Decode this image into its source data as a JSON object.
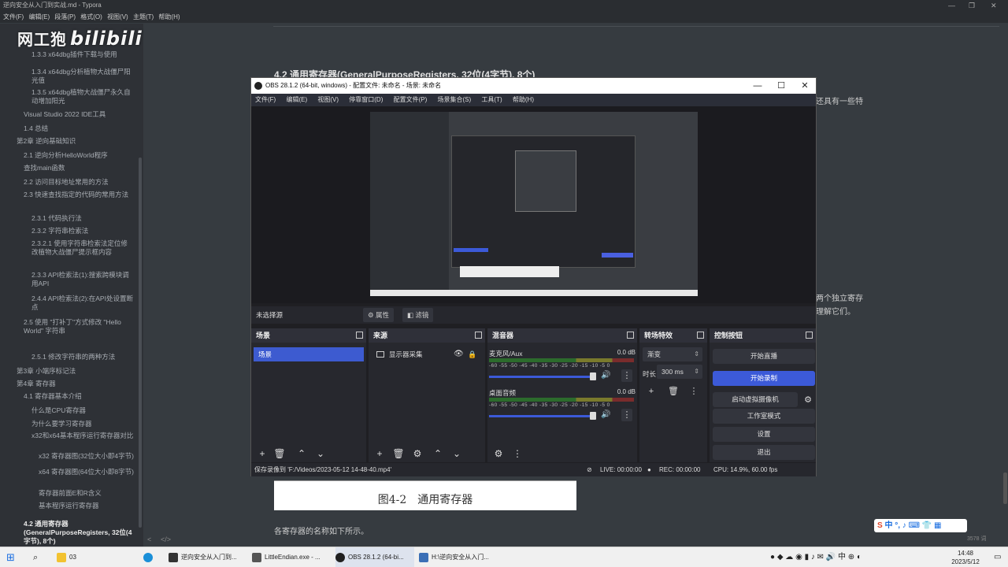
{
  "typora": {
    "title": "逆向安全从入门到实战.md - Typora",
    "menu": [
      "文件(F)",
      "编辑(E)",
      "段落(P)",
      "格式(O)",
      "视图(V)",
      "主题(T)",
      "帮助(H)"
    ],
    "toc": [
      {
        "text": "1.3.3 x64dbg插件下载与使用",
        "indent": 40,
        "active": false
      },
      {
        "text": "1.3.4 x64dbg分析植物大战僵尸阳光值",
        "indent": 40,
        "active": false
      },
      {
        "text": "1.3.5 x64dbg植物大战僵尸永久自动增加阳光",
        "indent": 40,
        "active": false
      },
      {
        "text": "Visual Studio 2022 IDE工具",
        "indent": 30,
        "active": false
      },
      {
        "text": "1.4 总结",
        "indent": 30,
        "active": false
      },
      {
        "text": "第2章 逆向基础知识",
        "indent": 21,
        "active": false
      },
      {
        "text": "2.1 逆向分析HelloWorld程序",
        "indent": 30,
        "active": false
      },
      {
        "text": "查找main函数",
        "indent": 30,
        "active": false
      },
      {
        "text": "2.2 访问目标地址常用的方法",
        "indent": 30,
        "active": false
      },
      {
        "text": "2.3 快速查找指定的代码的常用方法",
        "indent": 30,
        "active": false
      },
      {
        "text": "2.3.1 代码执行法",
        "indent": 40,
        "active": false
      },
      {
        "text": "2.3.2 字符串检索法",
        "indent": 40,
        "active": false
      },
      {
        "text": "2.3.2.1 使用字符串检索法定位修改植物大战僵尸提示框内容",
        "indent": 40,
        "active": false
      },
      {
        "text": "2.3.3 API检索法(1):搜索跨模块调用API",
        "indent": 40,
        "active": false
      },
      {
        "text": "2.4.4 API检索法(2):在API处设置断点",
        "indent": 40,
        "active": false
      },
      {
        "text": "2.5 使用 \"打补丁\"方式修改 \"Hello World\" 字符串",
        "indent": 30,
        "active": false
      },
      {
        "text": "2.5.1 修改字符串的两种方法",
        "indent": 40,
        "active": false
      },
      {
        "text": "第3章 小端序标记法",
        "indent": 21,
        "active": false
      },
      {
        "text": "第4章 寄存器",
        "indent": 21,
        "active": false
      },
      {
        "text": "4.1 寄存器基本介绍",
        "indent": 30,
        "active": false
      },
      {
        "text": "什么是CPU寄存器",
        "indent": 40,
        "active": false
      },
      {
        "text": "为什么要学习寄存器",
        "indent": 40,
        "active": false
      },
      {
        "text": "x32和x64基本程序运行寄存器对比",
        "indent": 40,
        "active": false
      },
      {
        "text": "x32 寄存器图(32位大小即4字节)",
        "indent": 49,
        "active": false
      },
      {
        "text": "x64 寄存器图(64位大小即8字节)",
        "indent": 49,
        "active": false
      },
      {
        "text": "寄存器前面E和R含义",
        "indent": 49,
        "active": false
      },
      {
        "text": "基本程序运行寄存器",
        "indent": 49,
        "active": false
      },
      {
        "text": "4.2 通用寄存器(GeneralPurposeRegisters, 32位(4字节), 8个)",
        "indent": 30,
        "active": true
      }
    ],
    "doc_heading": "4.2 通用寄存器(GeneralPurposeRegisters, 32位(4字节), 8个)",
    "doc_right1": "还具有一些特",
    "doc_right2": "两个独立寄存",
    "doc_right3": "理解它们。",
    "figure_caption": "图4-2　通用寄存器",
    "doc_after": "各寄存器的名称如下所示。",
    "word_count": "3578 词",
    "bottom_icons": [
      "<",
      "</>"
    ]
  },
  "watermark": {
    "text": "网工狍",
    "logo": "bilibili"
  },
  "obs": {
    "title": "OBS 28.1.2 (64-bit, windows) - 配置文件: 未命名 - 场景: 未命名",
    "menu": [
      "文件(F)",
      "编辑(E)",
      "视图(V)",
      "停靠窗口(D)",
      "配置文件(P)",
      "场景集合(S)",
      "工具(T)",
      "帮助(H)"
    ],
    "no_source": "未选择源",
    "props_label": "属性",
    "filters_label": "滤镜",
    "scenes": {
      "title": "场景",
      "items": [
        "场景"
      ]
    },
    "sources": {
      "title": "来源",
      "items": [
        "显示器采集"
      ]
    },
    "mixer": {
      "title": "混音器",
      "scale": "-60 -55 -50 -45 -40 -35 -30 -25 -20 -15 -10 -5 0",
      "channels": [
        {
          "name": "麦克风/Aux",
          "db": "0.0 dB"
        },
        {
          "name": "桌面音频",
          "db": "0.0 dB"
        }
      ]
    },
    "transitions": {
      "title": "转场特效",
      "selected": "渐变",
      "duration_label": "时长",
      "duration": "300 ms"
    },
    "controls": {
      "title": "控制按钮",
      "buttons": [
        "开始直播",
        "开始录制",
        "启动虚拟摄像机",
        "工作室模式",
        "设置",
        "退出"
      ]
    },
    "status": {
      "path": "保存录像到 'F:/Videos/2023-05-12 14-48-40.mp4'",
      "live": "LIVE: 00:00:00",
      "rec": "REC: 00:00:00",
      "cpu": "CPU: 14.9%, 60.00 fps"
    }
  },
  "taskbar": {
    "items": [
      {
        "label": "03",
        "color": "#f2c230"
      },
      {
        "label": "逆向安全从入门到...",
        "color": "#333333"
      },
      {
        "label": "LittleEndian.exe - ...",
        "color": "#555555"
      },
      {
        "label": "OBS 28.1.2 (64-bi...",
        "color": "#202020"
      },
      {
        "label": "H:\\逆向安全从入门...",
        "color": "#3b6fb6"
      }
    ],
    "time": "14:48",
    "date": "2023/5/12"
  },
  "ime": {
    "text": "中 °, ♪ ⌨ 👕 ▦"
  }
}
